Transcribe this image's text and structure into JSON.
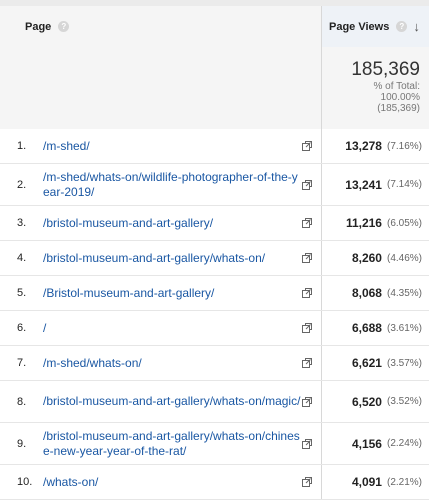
{
  "table": {
    "page_header": "Page",
    "views_header": "Page Views",
    "help_glyph": "?",
    "sort_glyph": "↓",
    "total": {
      "value": "185,369",
      "label": "% of Total:",
      "percent": "100.00%",
      "of": "(185,369)"
    },
    "rows": [
      {
        "num": "1.",
        "path": "/m-shed/",
        "views": "13,278",
        "pct": "(7.16%)"
      },
      {
        "num": "2.",
        "path": "/m-shed/whats-on/wildlife-photographer-of-the-year-2019/",
        "views": "13,241",
        "pct": "(7.14%)"
      },
      {
        "num": "3.",
        "path": "/bristol-museum-and-art-gallery/",
        "views": "11,216",
        "pct": "(6.05%)"
      },
      {
        "num": "4.",
        "path": "/bristol-museum-and-art-gallery/whats-on/",
        "views": "8,260",
        "pct": "(4.46%)"
      },
      {
        "num": "5.",
        "path": "/Bristol-museum-and-art-gallery/",
        "views": "8,068",
        "pct": "(4.35%)"
      },
      {
        "num": "6.",
        "path": "/",
        "views": "6,688",
        "pct": "(3.61%)"
      },
      {
        "num": "7.",
        "path": "/m-shed/whats-on/",
        "views": "6,621",
        "pct": "(3.57%)"
      },
      {
        "num": "8.",
        "path": "/bristol-museum-and-art-gallery/whats-on/magic/",
        "views": "6,520",
        "pct": "(3.52%)"
      },
      {
        "num": "9.",
        "path": "/bristol-museum-and-art-gallery/whats-on/chinese-new-year-year-of-the-rat/",
        "views": "4,156",
        "pct": "(2.24%)"
      },
      {
        "num": "10.",
        "path": "/whats-on/",
        "views": "4,091",
        "pct": "(2.21%)"
      }
    ]
  }
}
